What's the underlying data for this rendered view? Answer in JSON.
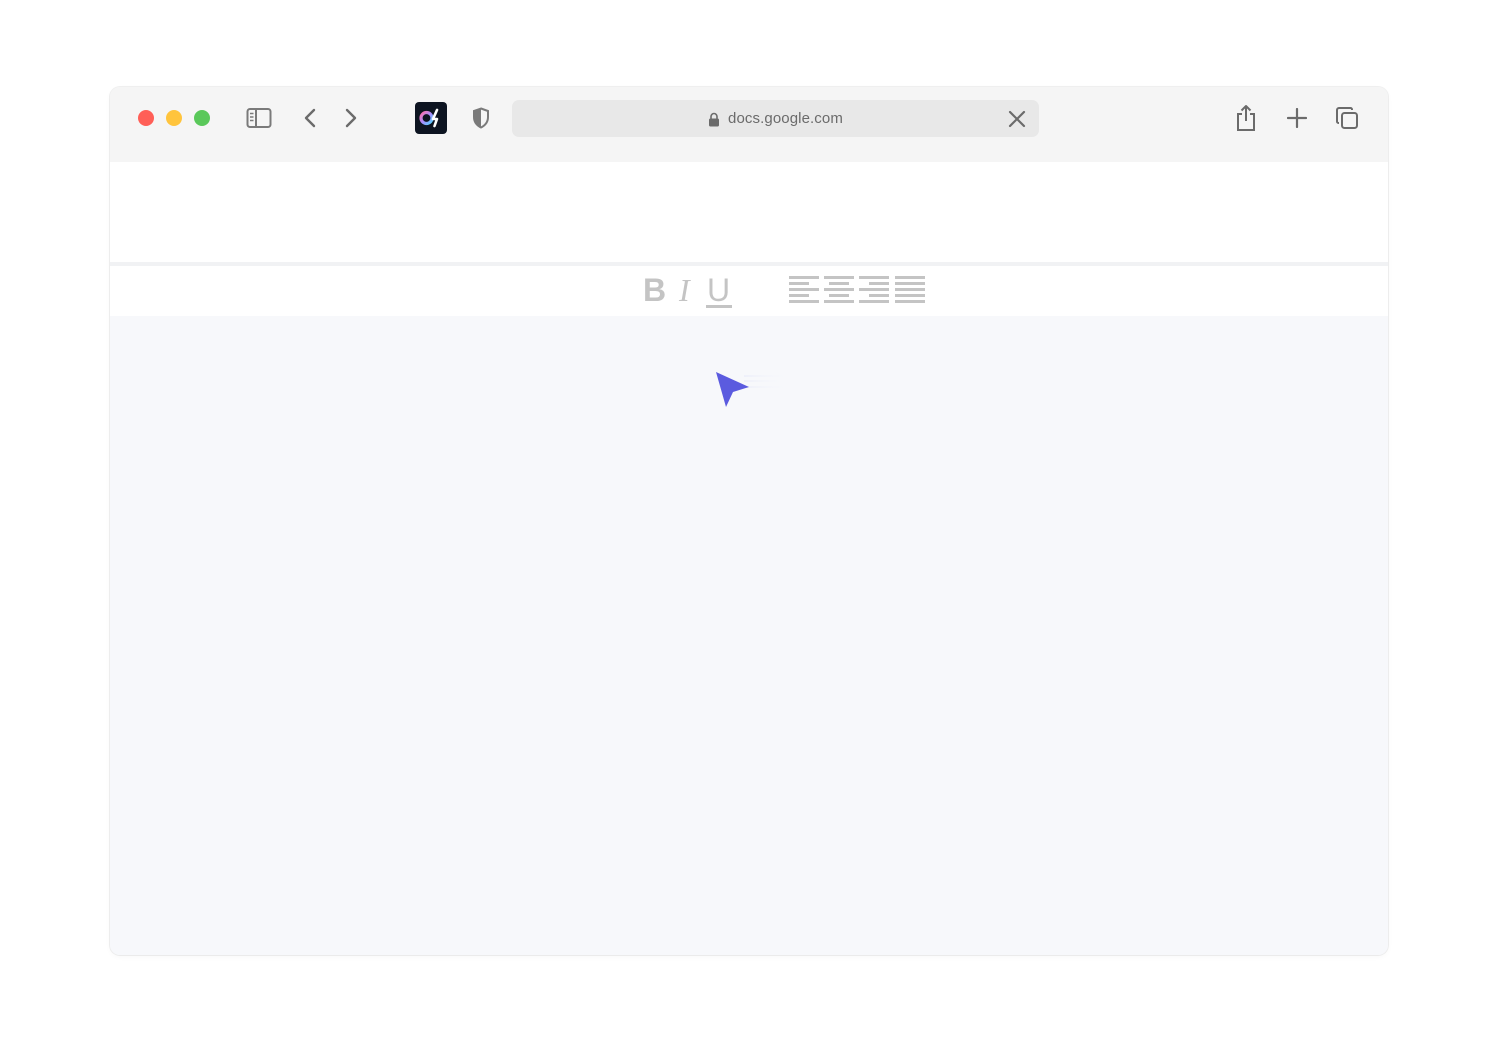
{
  "browser": {
    "url": "docs.google.com",
    "traffic_lights": {
      "close": "#ff5f57",
      "minimize": "#ffc43d",
      "zoom": "#5ac85a"
    },
    "icons": [
      "sidebar-icon",
      "chevron-left-icon",
      "chevron-right-icon",
      "extension-logo-icon",
      "shield-icon",
      "lock-icon",
      "close-icon",
      "share-icon",
      "plus-icon",
      "tabs-icon"
    ]
  },
  "toolbar": {
    "bold_label": "B",
    "italic_label": "I",
    "underline_label": "U",
    "alignments": [
      "align-left",
      "align-center",
      "align-right",
      "align-justify"
    ],
    "icon_color": "#c4c4c4"
  },
  "cursor": {
    "icon": "pointer-arrow-icon",
    "color": "#5b5bdf"
  }
}
